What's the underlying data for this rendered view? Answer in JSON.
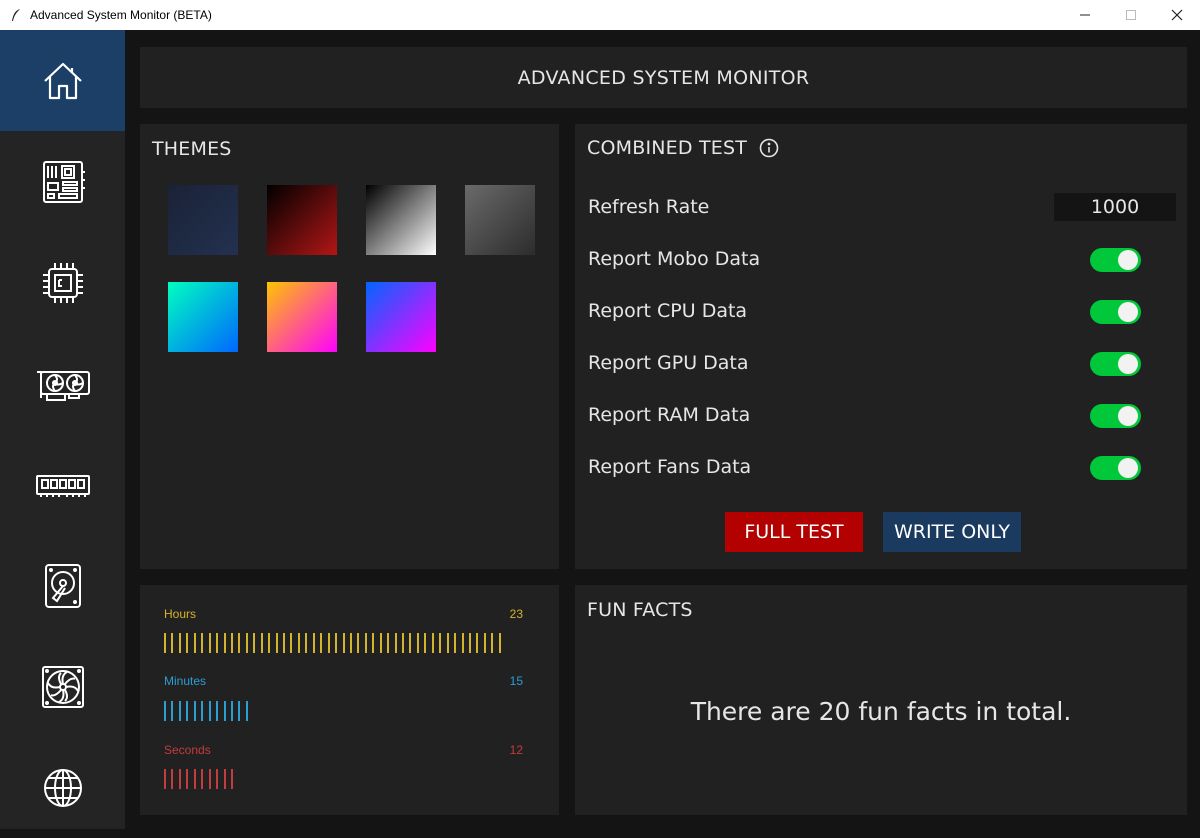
{
  "window": {
    "title": "Advanced System Monitor (BETA)"
  },
  "sidebar": {
    "items": [
      {
        "icon": "home-icon",
        "active": true
      },
      {
        "icon": "motherboard-icon",
        "active": false
      },
      {
        "icon": "cpu-icon",
        "active": false
      },
      {
        "icon": "gpu-icon",
        "active": false
      },
      {
        "icon": "ram-icon",
        "active": false
      },
      {
        "icon": "hard-drive-icon",
        "active": false
      },
      {
        "icon": "fan-icon",
        "active": false
      },
      {
        "icon": "globe-icon",
        "active": false
      }
    ]
  },
  "header": {
    "title": "ADVANCED SYSTEM MONITOR"
  },
  "themes": {
    "title": "THEMES",
    "swatches": [
      {
        "name": "navy",
        "from": "#1a2236",
        "to": "#233150"
      },
      {
        "name": "black-red",
        "from": "#000000",
        "to": "#b31616"
      },
      {
        "name": "black-white",
        "from": "#000000",
        "to": "#ffffff"
      },
      {
        "name": "gray",
        "from": "#6a6a6a",
        "to": "#2c2c2c"
      },
      {
        "name": "cyan-blue",
        "from": "#00ffbf",
        "to": "#0066ff"
      },
      {
        "name": "orange-magenta",
        "from": "#ffc400",
        "to": "#ff00ff"
      },
      {
        "name": "blue-magenta",
        "from": "#0066ff",
        "to": "#ff00ff"
      }
    ]
  },
  "combined_test": {
    "title": "COMBINED TEST",
    "refresh_rate_label": "Refresh Rate",
    "refresh_rate_value": "1000",
    "toggles": [
      {
        "label": "Report Mobo Data",
        "on": true
      },
      {
        "label": "Report CPU Data",
        "on": true
      },
      {
        "label": "Report GPU Data",
        "on": true
      },
      {
        "label": "Report RAM Data",
        "on": true
      },
      {
        "label": "Report Fans Data",
        "on": true
      }
    ],
    "full_test_label": "FULL TEST",
    "write_only_label": "WRITE ONLY"
  },
  "uptime": {
    "hours_label": "Hours",
    "hours_value": "23",
    "minutes_label": "Minutes",
    "minutes_value": "15",
    "seconds_label": "Seconds",
    "seconds_value": "12",
    "colors": {
      "hours": "#d4b42a",
      "minutes": "#2a9fd4",
      "seconds": "#c43c3c"
    }
  },
  "fun_facts": {
    "title": "FUN FACTS",
    "text": "There are 20 fun facts in total."
  }
}
